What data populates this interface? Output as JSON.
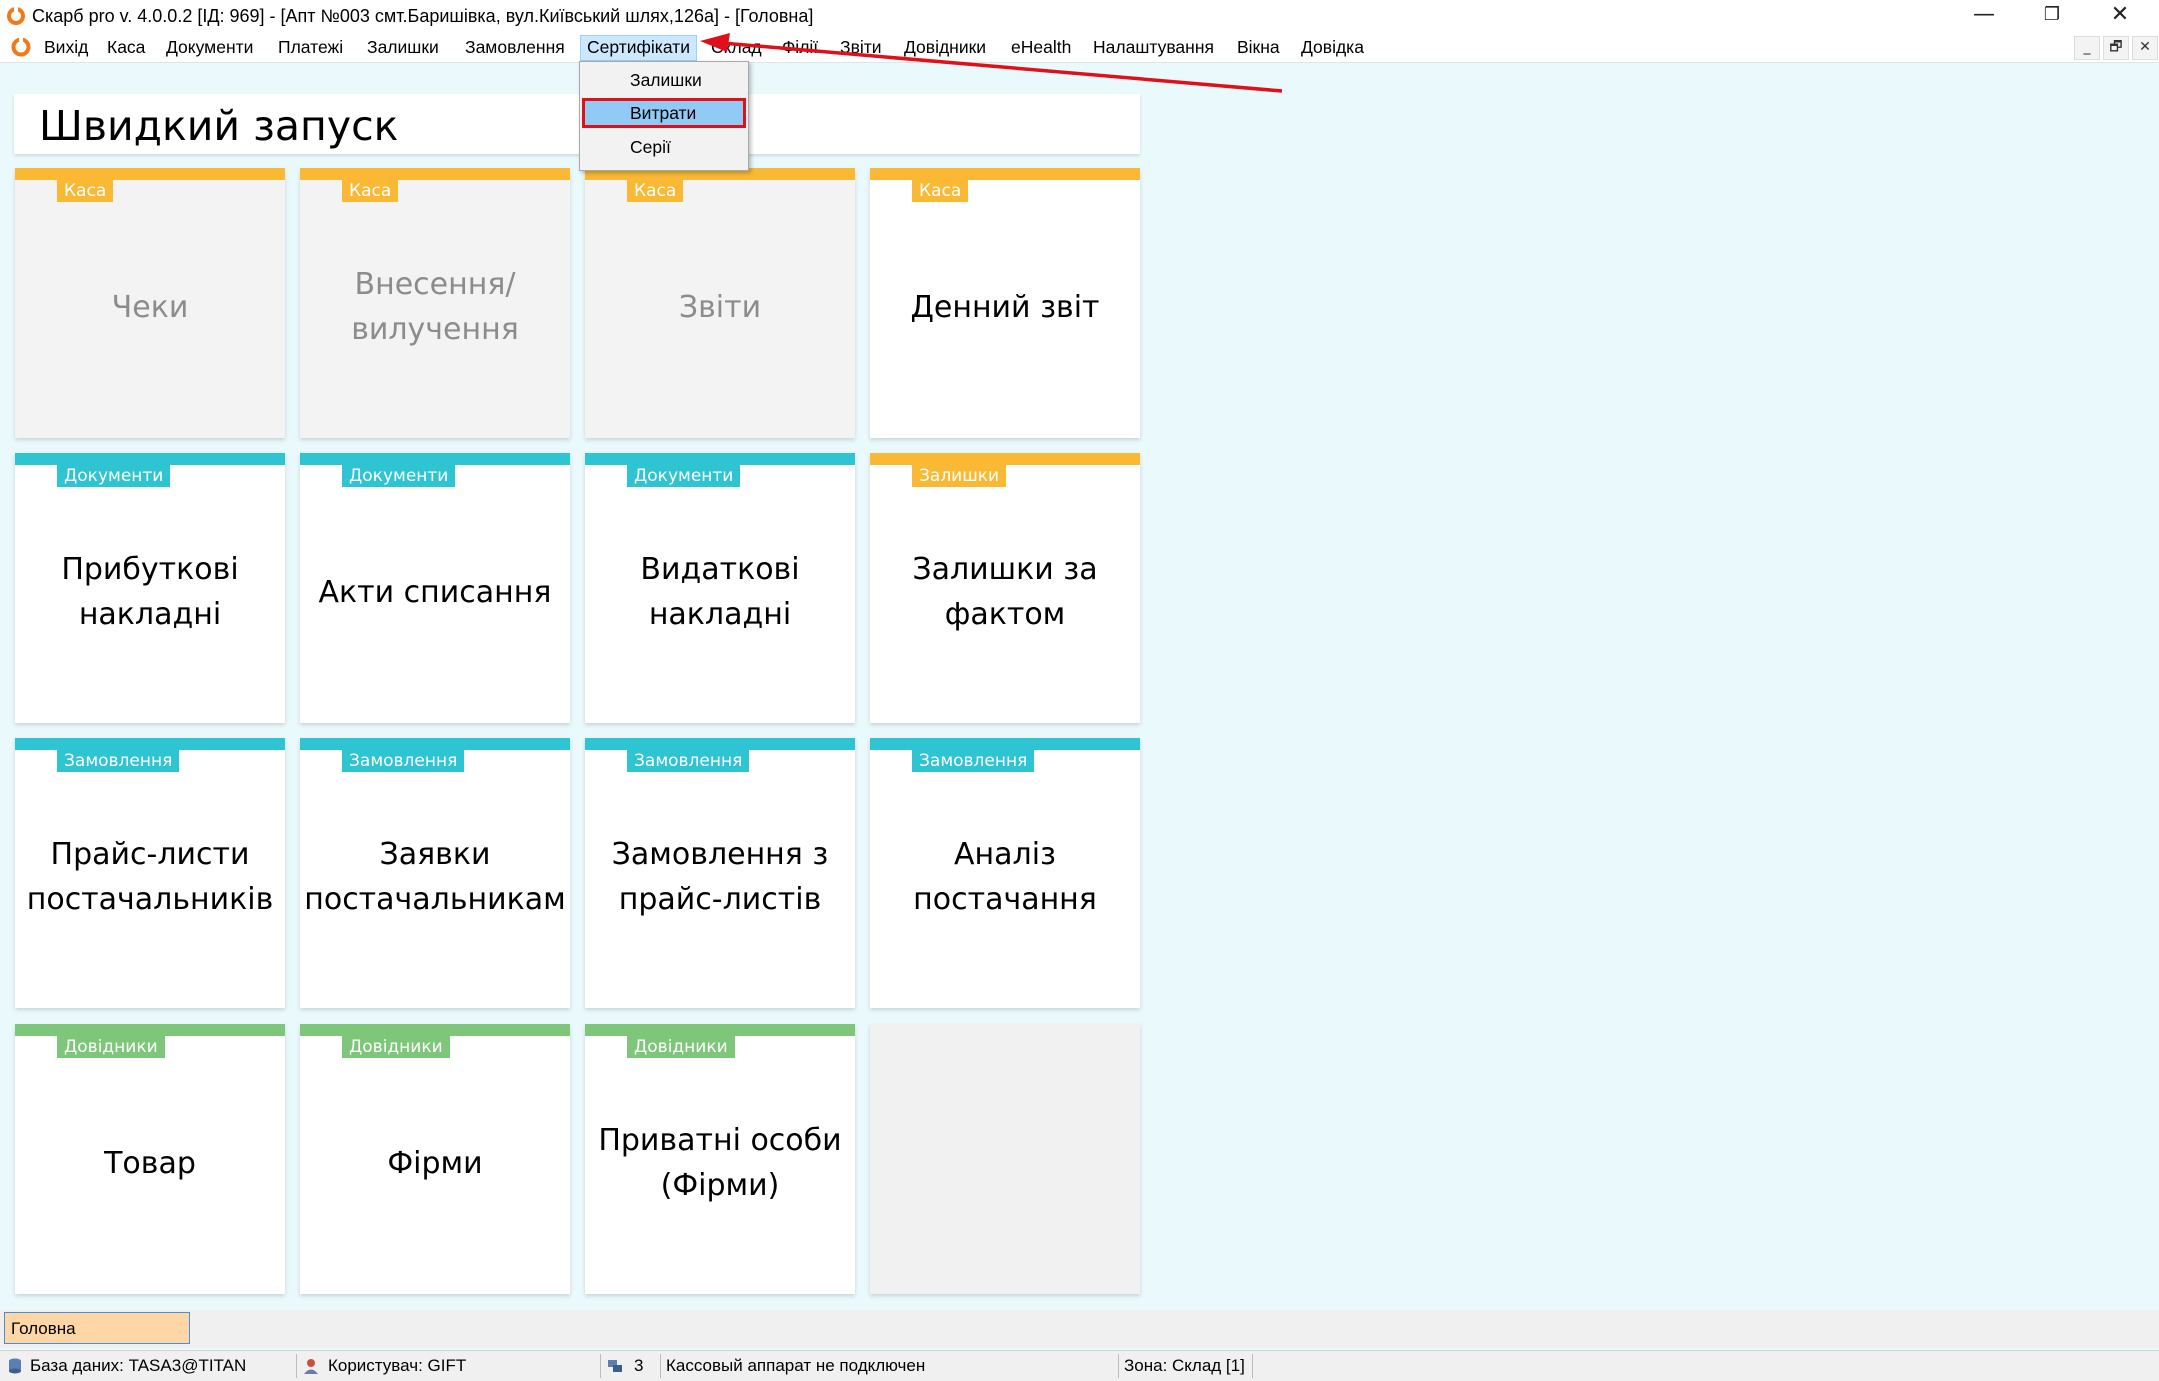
{
  "window": {
    "title": "Скарб pro v. 4.0.0.2 [ІД: 969] - [Апт №003 смт.Баришівка, вул.Київський шлях,126а] - [Головна]",
    "minimize_glyph": "—",
    "restore_glyph": "❐",
    "close_glyph": "✕"
  },
  "menubar": {
    "items": [
      "Вихід",
      "Каса",
      "Документи",
      "Платежі",
      "Залишки",
      "Замовлення",
      "Сертифікати",
      "Склад",
      "Філії",
      "Звіти",
      "Довідники",
      "eHealth",
      "Налаштування",
      "Вікна",
      "Довідка"
    ],
    "active_index": 6,
    "mdi_minimize": "_",
    "mdi_restore": "🗗",
    "mdi_close": "✕"
  },
  "dropdown": {
    "items": [
      "Залишки",
      "Витрати",
      "Серії"
    ],
    "selected_index": 1
  },
  "quick_start": {
    "title": "Швидкий запуск"
  },
  "tiles": [
    {
      "category": "Каса",
      "label": "Чеки",
      "color": "#f9b934",
      "disabled": true
    },
    {
      "category": "Каса",
      "label": "Внесення/вилучення",
      "color": "#f9b934",
      "disabled": true
    },
    {
      "category": "Каса",
      "label": "Звіти",
      "color": "#f9b934",
      "disabled": true
    },
    {
      "category": "Каса",
      "label": "Денний звіт",
      "color": "#f9b934",
      "disabled": false
    },
    {
      "category": "Документи",
      "label": "Прибуткові накладні",
      "color": "#2ec4d1",
      "disabled": false
    },
    {
      "category": "Документи",
      "label": "Акти списання",
      "color": "#2ec4d1",
      "disabled": false
    },
    {
      "category": "Документи",
      "label": "Видаткові накладні",
      "color": "#2ec4d1",
      "disabled": false
    },
    {
      "category": "Залишки",
      "label": "Залишки за фактом",
      "color": "#f9b934",
      "disabled": false
    },
    {
      "category": "Замовлення",
      "label": "Прайс-листи постачальників",
      "color": "#2ec4d1",
      "disabled": false
    },
    {
      "category": "Замовлення",
      "label": "Заявки постачальникам",
      "color": "#2ec4d1",
      "disabled": false
    },
    {
      "category": "Замовлення",
      "label": "Замовлення з прайс-листів",
      "color": "#2ec4d1",
      "disabled": false
    },
    {
      "category": "Замовлення",
      "label": "Аналіз постачання",
      "color": "#2ec4d1",
      "disabled": false
    },
    {
      "category": "Довідники",
      "label": "Товар",
      "color": "#7dc67a",
      "disabled": false
    },
    {
      "category": "Довідники",
      "label": "Фірми",
      "color": "#7dc67a",
      "disabled": false
    },
    {
      "category": "Довідники",
      "label": "Приватні особи (Фірми)",
      "color": "#7dc67a",
      "disabled": false
    }
  ],
  "tabs": {
    "active": "Головна"
  },
  "statusbar": {
    "database": "База даних: TASA3@TITAN",
    "user": "Користувач: GIFT",
    "count": "3",
    "cash_register": "Кассовый аппарат не подключен",
    "zone": "Зона: Склад [1]"
  },
  "colors": {
    "accent_red": "#e0101a",
    "menu_highlight": "#cce8ff",
    "selected_item": "#91c9f7",
    "background": "#eaf9fc"
  }
}
